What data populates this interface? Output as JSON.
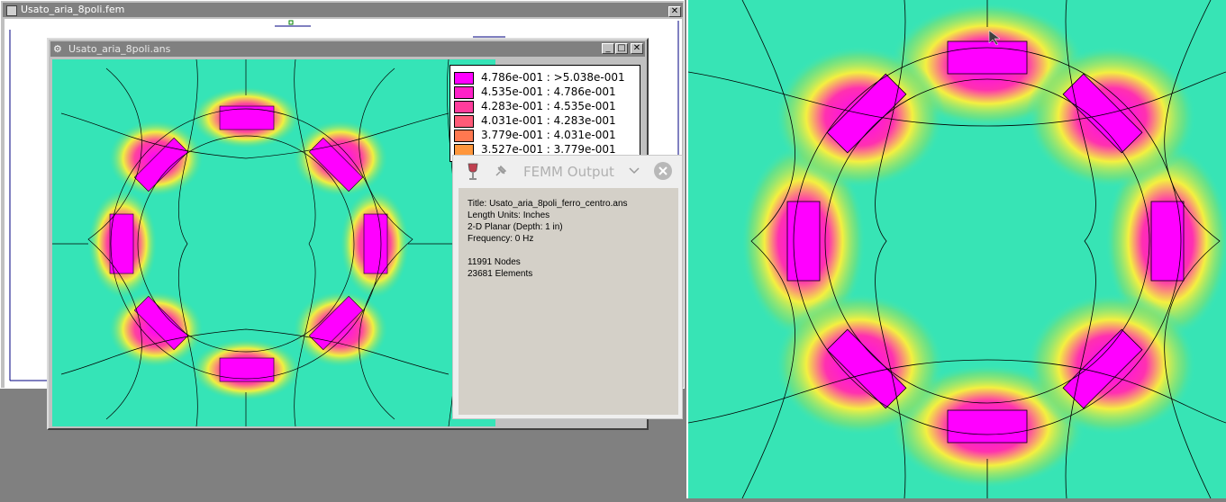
{
  "fem_window": {
    "title": "Usato_aria_8poli.fem"
  },
  "ans_window": {
    "title": "Usato_aria_8poli.ans",
    "buttons": {
      "minimize": "_",
      "maximize": "□",
      "close": "✕"
    }
  },
  "legend": {
    "rows": [
      {
        "label": "4.786e-001 : >5.038e-001",
        "color": "#ff00ff"
      },
      {
        "label": "4.535e-001 : 4.786e-001",
        "color": "#ff20c8"
      },
      {
        "label": "4.283e-001 : 4.535e-001",
        "color": "#ff3c9c"
      },
      {
        "label": "4.031e-001 : 4.283e-001",
        "color": "#ff5a78"
      },
      {
        "label": "3.779e-001 : 4.031e-001",
        "color": "#ff7850"
      },
      {
        "label": "3.527e-001 : 3.779e-001",
        "color": "#ff963c"
      }
    ]
  },
  "output": {
    "title": "FEMM Output",
    "lines": [
      "Title: Usato_aria_8poli_ferro_centro.ans",
      "Length Units: Inches",
      "2-D Planar (Depth: 1 in)",
      "Frequency: 0 Hz",
      "",
      "11991 Nodes",
      "23681 Elements"
    ]
  },
  "colors": {
    "field_bg": "#2ee6c4",
    "field_mid": "#58e08a",
    "field_yellow": "#f0f040",
    "field_high": "#ff00ff",
    "window_gray": "#c0c0c0"
  }
}
